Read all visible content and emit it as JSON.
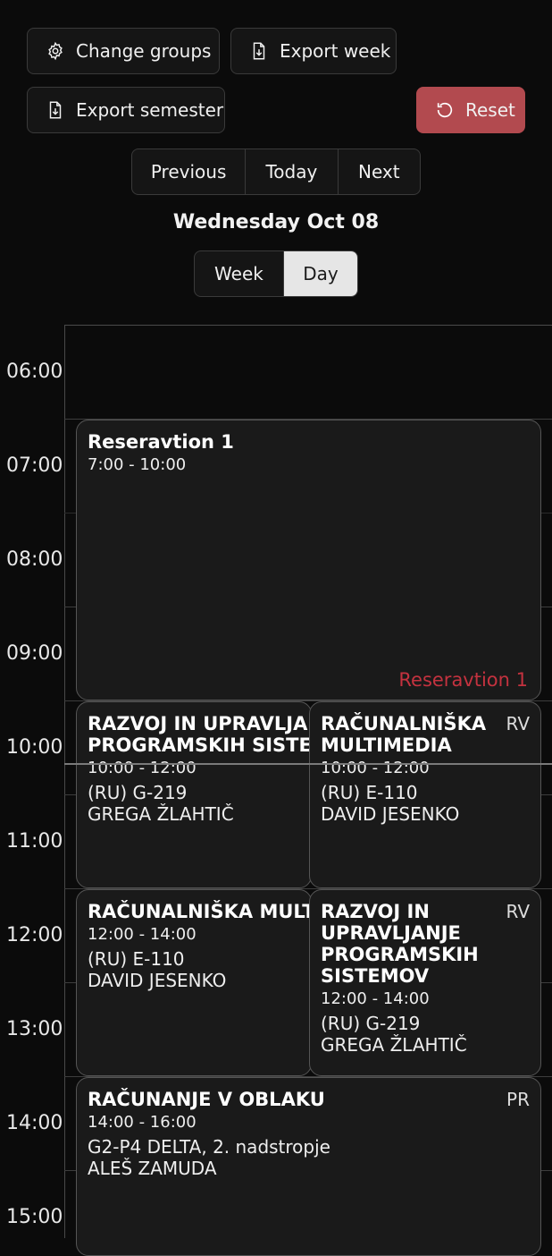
{
  "toolbar": {
    "change_groups": "Change groups",
    "export_week": "Export week",
    "export_semester": "Export semester",
    "reset": "Reset"
  },
  "nav": {
    "previous": "Previous",
    "today": "Today",
    "next": "Next"
  },
  "date_title": "Wednesday Oct 08",
  "view_toggle": {
    "week": "Week",
    "day": "Day",
    "active": "Day"
  },
  "time_labels": [
    "06:00",
    "07:00",
    "08:00",
    "09:00",
    "10:00",
    "11:00",
    "12:00",
    "13:00",
    "14:00",
    "15:00"
  ],
  "events": [
    {
      "title": "Reseravtion 1",
      "time": "7:00 - 10:00",
      "corner_label": "Reseravtion 1"
    },
    {
      "title": "RAZVOJ IN UPRAVLJA PROGRAMSKIH SISTE",
      "time": "10:00 - 12:00",
      "location": "(RU) G-219",
      "professor": "GREGA ŽLAHTIČ"
    },
    {
      "title": "RAČUNALNIŠKA MULTIMEDIA",
      "time": "10:00 - 12:00",
      "location": "(RU) E-110",
      "professor": "DAVID JESENKO",
      "tag": "RV"
    },
    {
      "title": "RAČUNALNIŠKA MULT",
      "time": "12:00 - 14:00",
      "location": "(RU) E-110",
      "professor": "DAVID JESENKO"
    },
    {
      "title": "RAZVOJ IN UPRAVLJANJE PROGRAMSKIH SISTEMOV",
      "time": "12:00 - 14:00",
      "location": "(RU) G-219",
      "professor": "GREGA ŽLAHTIČ",
      "tag": "RV"
    },
    {
      "title": "RAČUNANJE V OBLAKU",
      "time": "14:00 - 16:00",
      "location": "G2-P4 DELTA, 2. nadstropje",
      "professor": "ALEŠ ZAMUDA",
      "tag": "PR"
    }
  ],
  "colors": {
    "reset_bg": "#b24a4f",
    "reservation_label": "#c4323f",
    "background": "#0b0b0b"
  }
}
